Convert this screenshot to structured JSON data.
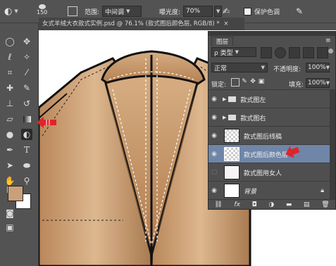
{
  "options_bar": {
    "brush_size": "150",
    "range_label": "范围:",
    "range_value": "中间调",
    "exposure_label": "曝光度:",
    "exposure_value": "70%",
    "protect_tones_label": "保护色调"
  },
  "document": {
    "tab_title": "女式羊绒大衣款式实例.psd @ 76.1% (款式图后颜色层, RGB/8) *",
    "tab_close": "×"
  },
  "layers_panel": {
    "title": "图层",
    "filter_label": "ρ 类型",
    "blend_mode": "正常",
    "opacity_label": "不透明度:",
    "opacity_value": "100%",
    "lock_label": "锁定:",
    "fill_label": "填充:",
    "fill_value": "100%",
    "layers": [
      {
        "name": "款式图左",
        "type": "group"
      },
      {
        "name": "款式图右",
        "type": "group"
      },
      {
        "name": "款式图后线稿",
        "type": "layer"
      },
      {
        "name": "款式图后颜色层",
        "type": "layer",
        "selected": true
      },
      {
        "name": "款式图用女人",
        "type": "layer"
      },
      {
        "name": "背景",
        "type": "background"
      }
    ],
    "footer_icons": [
      "link-icon",
      "fx-icon",
      "mask-icon",
      "adjustment-icon",
      "folder-icon",
      "new-layer-icon",
      "trash-icon"
    ],
    "fx_label": "fx"
  },
  "colors": {
    "foreground": "#c8a07a",
    "background": "#ffffff",
    "selection": "#6f86a8",
    "annotation_arrow": "#e0242b",
    "coat_fill": "#c99a6c"
  }
}
